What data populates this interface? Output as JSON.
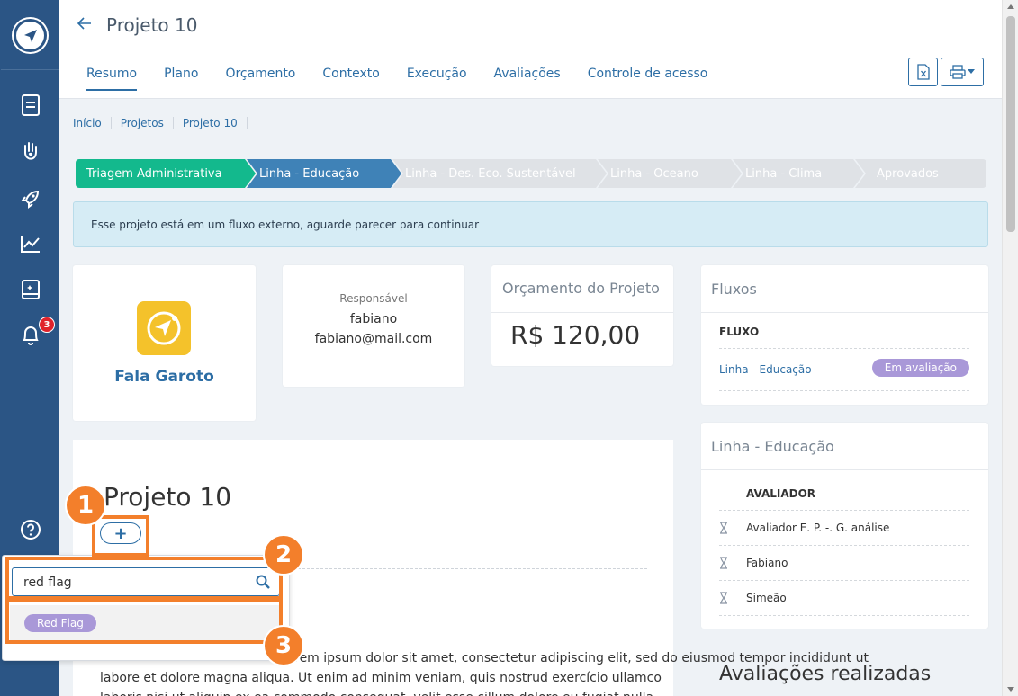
{
  "header": {
    "title": "Projeto 10",
    "tabs": [
      {
        "label": "Resumo"
      },
      {
        "label": "Plano"
      },
      {
        "label": "Orçamento"
      },
      {
        "label": "Contexto"
      },
      {
        "label": "Execução"
      },
      {
        "label": "Avaliações"
      },
      {
        "label": "Controle de acesso"
      }
    ]
  },
  "sidebar": {
    "notification_count": "3"
  },
  "breadcrumb": [
    "Início",
    "Projetos",
    "Projeto 10"
  ],
  "stepper": [
    {
      "label": "Triagem Administrativa",
      "state": "done"
    },
    {
      "label": "Linha - Educação",
      "state": "current"
    },
    {
      "label": "Linha - Des. Eco. Sustentável",
      "state": "todo"
    },
    {
      "label": "Linha - Oceano",
      "state": "todo"
    },
    {
      "label": "Linha - Clima",
      "state": "todo"
    },
    {
      "label": "Aprovados",
      "state": "todo"
    }
  ],
  "alert": "Esse projeto está em um fluxo externo, aguarde parecer para continuar",
  "org": {
    "name": "Fala Garoto"
  },
  "responsible": {
    "label": "Responsável",
    "name": "fabiano",
    "email": "fabiano@mail.com"
  },
  "budget": {
    "label": "Orçamento do Projeto",
    "value": "R$ 120,00"
  },
  "flows": {
    "title": "Fluxos",
    "column": "FLUXO",
    "rows": [
      {
        "name": "Linha - Educação",
        "status": "Em avaliação"
      }
    ]
  },
  "line_panel": {
    "title": "Linha - Educação",
    "column": "AVALIADOR",
    "rows": [
      "Avaliador E. P. -. G. análise",
      "Fabiano",
      "Simeão"
    ]
  },
  "evaluations_title": "Avaliações realizadas",
  "content": {
    "heading": "Projeto 10",
    "add_label": "+",
    "lorem_line1": "Lorem ipsum dolor sit amet, consectetur adipiscing elit, sed do eiusmod tempor incididunt ut",
    "lorem_line2": "labore et dolore magna aliqua. Ut enim ad minim veniam, quis nostrud exercício ullamco",
    "lorem_line3": "laboris nisi ut aliquip ex ea commodo consequat, velit esse cillum dolore eu fugiat nulla"
  },
  "dropdown": {
    "search_value": "red flag",
    "option": "Red Flag"
  },
  "callouts": [
    "1",
    "2",
    "3"
  ],
  "colors": {
    "sidebar": "#2b5585",
    "accent": "#2d6ea5",
    "step_done": "#13b98d",
    "step_current": "#3f82b7",
    "annotation": "#f37f2b",
    "pill": "#a998d8"
  }
}
